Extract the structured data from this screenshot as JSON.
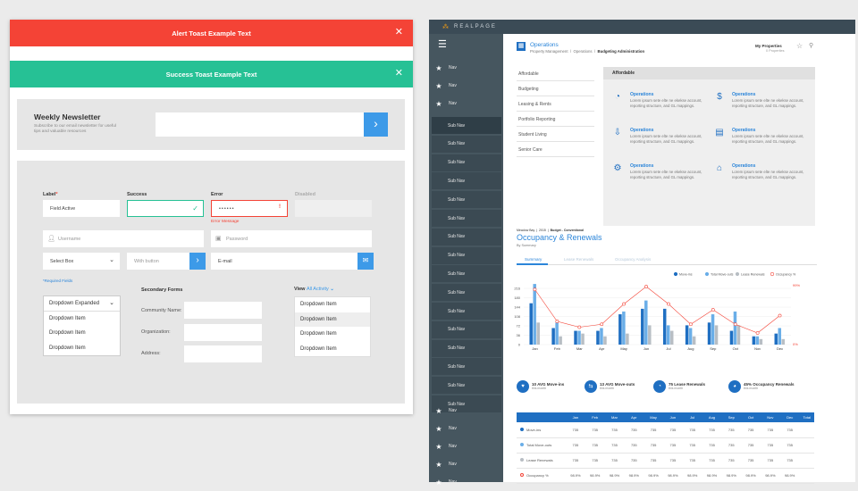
{
  "left": {
    "alert_toast": {
      "text": "Alert Toast Example Text",
      "color": "#f44336"
    },
    "success_toast": {
      "text": "Success Toast Example Text",
      "color": "#26c195"
    },
    "close_glyph": "✕",
    "newsletter": {
      "title": "Weekly Newsletter",
      "subtitle": "Subscribe to our email newsletter for useful tips and valuable resources",
      "button_glyph": "›"
    },
    "fields": {
      "label_label": "Label",
      "label_required": "*",
      "field_active_value": "Field Active",
      "success_label": "Success",
      "error_label": "Error",
      "error_value": "••••••",
      "error_icon": "!",
      "error_message": "Error Message",
      "disabled_label": "Disabled",
      "username_placeholder": "Username",
      "password_placeholder": "Password",
      "select_box": "Select Box",
      "with_button_placeholder": "With button",
      "email_placeholder": "E-mail",
      "required_note": "*Required Fields"
    },
    "dropdown": {
      "selected": "Dropdown Expanded",
      "items": [
        "Dropdown Item",
        "Dropdown Item",
        "Dropdown Item"
      ]
    },
    "secondary": {
      "title": "Secondary Forms",
      "labels": [
        "Community Name:",
        "Organization:",
        "Address:"
      ]
    },
    "view": {
      "label": "View",
      "link": "All Activity",
      "items": [
        "Dropdown Item",
        "Dropdown Item",
        "Dropdown Item",
        "Dropdown Item"
      ]
    },
    "colors": {
      "accent": "#3d9ae8",
      "success": "#26c195",
      "error": "#f44336"
    }
  },
  "right": {
    "brand": "REALPAGE",
    "nav_label": "Nav",
    "subnav_label": "Sub Nav",
    "nav_top_count": 3,
    "subnav_count": 16,
    "nav_bottom_count": 5,
    "header": {
      "title": "Operations",
      "breadcrumb": [
        "Property Management",
        "Operations",
        "Budgeting Administration"
      ],
      "my_properties": "My Properties",
      "properties_count": "0 Properties"
    },
    "menu": [
      "Affordable",
      "Budgeting",
      "Leasing & Rents",
      "Portfolio Reporting",
      "Student Living",
      "Senior Care"
    ],
    "panel_title": "Affordable",
    "operations": [
      {
        "title": "Operations",
        "desc": "Lorem ipsum sete elte ne ekekse account, reporting structure, and GL mappings.",
        "icon": "pie-chart-icon",
        "glyph": "◔"
      },
      {
        "title": "Operations",
        "desc": "Lorem ipsum sete elte ne ekekse account, reporting structure, and GL mappings.",
        "icon": "dollar-icon",
        "glyph": "$"
      },
      {
        "title": "Operations",
        "desc": "Lorem ipsum sete elte ne ekekse account, reporting structure, and GL mappings.",
        "icon": "inbox-icon",
        "glyph": "⇩"
      },
      {
        "title": "Operations",
        "desc": "Lorem ipsum sete elte ne ekekse account, reporting structure, and GL mappings.",
        "icon": "document-icon",
        "glyph": "▤"
      },
      {
        "title": "Operations",
        "desc": "Lorem ipsum sete elte ne ekekse account, reporting structure, and GL mappings.",
        "icon": "gears-icon",
        "glyph": "⚙"
      },
      {
        "title": "Operations",
        "desc": "Lorem ipsum sete elte ne ekekse account, reporting structure, and GL mappings.",
        "icon": "bank-icon",
        "glyph": "⌂"
      }
    ],
    "report": {
      "meta": [
        "Meadow Bay",
        "2015",
        "Budget - Conventional"
      ],
      "title": "Occupancy & Renewals",
      "subtitle": "By Summary",
      "tabs": [
        "Summary",
        "Lease Renewals",
        "Occupancy Analysis"
      ]
    },
    "stats": [
      {
        "value": "10 AVG Move-ins",
        "sub": "this month"
      },
      {
        "value": "13 AVG Move-outs",
        "sub": "this month"
      },
      {
        "value": "75 Lease Renewals",
        "sub": "this month"
      },
      {
        "value": "45% Occupancy Renewals",
        "sub": "this month"
      }
    ],
    "table": {
      "headers": [
        "Jan",
        "Feb",
        "Mar",
        "Apr",
        "May",
        "Jun",
        "Jul",
        "Aug",
        "Sep",
        "Oct",
        "Nov",
        "Dec",
        "Total"
      ],
      "rows": [
        {
          "label": "Move-ins",
          "color": "#1f6fc2",
          "values": [
            "735",
            "735",
            "735",
            "735",
            "735",
            "735",
            "735",
            "735",
            "735",
            "735",
            "735",
            "735"
          ]
        },
        {
          "label": "Total Move-outs",
          "color": "#6aaee8",
          "values": [
            "735",
            "735",
            "735",
            "735",
            "735",
            "735",
            "735",
            "735",
            "735",
            "735",
            "735",
            "735"
          ]
        },
        {
          "label": "Lease Renewals",
          "color": "#b8bec4",
          "values": [
            "735",
            "735",
            "735",
            "735",
            "735",
            "735",
            "735",
            "735",
            "735",
            "735",
            "735",
            "735"
          ]
        },
        {
          "label": "Occupancy %",
          "color": "#f44336",
          "values": [
            "98.9%",
            "98.9%",
            "98.9%",
            "98.9%",
            "98.9%",
            "98.9%",
            "98.9%",
            "98.9%",
            "98.9%",
            "98.9%",
            "98.9%",
            "98.9%"
          ]
        }
      ]
    }
  },
  "chart_data": {
    "type": "bar",
    "categories": [
      "Jan",
      "Feb",
      "Mar",
      "Apr",
      "May",
      "Jun",
      "Jul",
      "Aug",
      "Sep",
      "Oct",
      "Nov",
      "Dec"
    ],
    "series": [
      {
        "name": "Move-ins",
        "color": "#1f6fc2",
        "values": [
          150,
          60,
          50,
          50,
          110,
          130,
          130,
          70,
          80,
          50,
          30,
          40
        ]
      },
      {
        "name": "Total Move-outs",
        "color": "#6aaee8",
        "values": [
          220,
          80,
          50,
          60,
          120,
          160,
          70,
          60,
          110,
          120,
          30,
          60
        ]
      },
      {
        "name": "Lease Renewals",
        "color": "#b8bec4",
        "values": [
          80,
          30,
          40,
          30,
          40,
          70,
          50,
          30,
          70,
          70,
          20,
          20
        ]
      }
    ],
    "line": {
      "name": "Occupancy %",
      "color": "#f44336",
      "values": [
        95,
        40,
        30,
        35,
        70,
        100,
        70,
        35,
        60,
        35,
        20,
        50
      ]
    },
    "yticks": [
      "216",
      "180",
      "144",
      "108",
      "72",
      "36",
      "0"
    ],
    "ylim": [
      0,
      230
    ],
    "legend": [
      "Move-ins",
      "Total Move-outs",
      "Lease Renewals",
      "Occupancy %"
    ],
    "legend_position": "top-right",
    "right_top_label": "99%",
    "right_bottom_label": "0%"
  }
}
